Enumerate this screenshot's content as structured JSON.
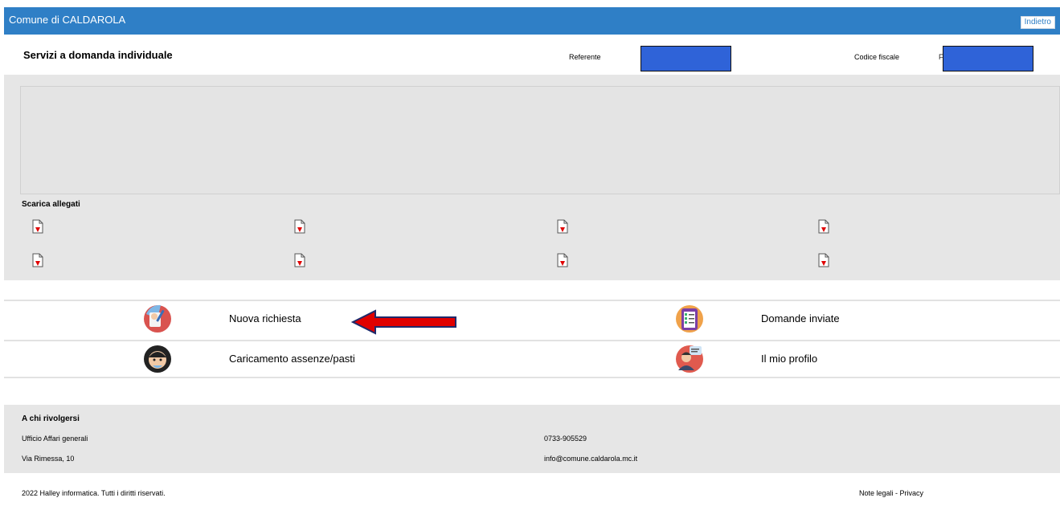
{
  "header_bar": {
    "title": "Comune di CALDAROLA",
    "back_label": "Indietro"
  },
  "service": {
    "title": "Servizi a domanda individuale",
    "referente_label": "Referente",
    "codice_fiscale_label": "Codice fiscale",
    "codice_fiscale_prefix": "F"
  },
  "downloads": {
    "title": "Scarica allegati",
    "icon_name": "pdf-download-icon",
    "count": 8
  },
  "menu": {
    "items": [
      {
        "label": "Nuova richiesta",
        "icon": "new-request-icon"
      },
      {
        "label": "Domande inviate",
        "icon": "checklist-icon"
      },
      {
        "label": "Caricamento assenze/pasti",
        "icon": "operator-icon"
      },
      {
        "label": "Il mio profilo",
        "icon": "profile-icon"
      }
    ],
    "arrow_icon": "red-arrow-left-icon"
  },
  "contact": {
    "heading": "A chi rivolgersi",
    "office": "Ufficio Affari generali",
    "address": "Via Rimessa, 10",
    "phone": "0733-905529",
    "email": "info@comune.caldarola.mc.it"
  },
  "footer": {
    "copyright": "2022 Halley informatica. Tutti i diritti riservati.",
    "links": "Note legali - Privacy"
  },
  "colors": {
    "topbar": "#2f7fc6",
    "redacted_box": "#2f63d8",
    "section_gray": "#e6e6e6",
    "arrow_red": "#e00000"
  }
}
